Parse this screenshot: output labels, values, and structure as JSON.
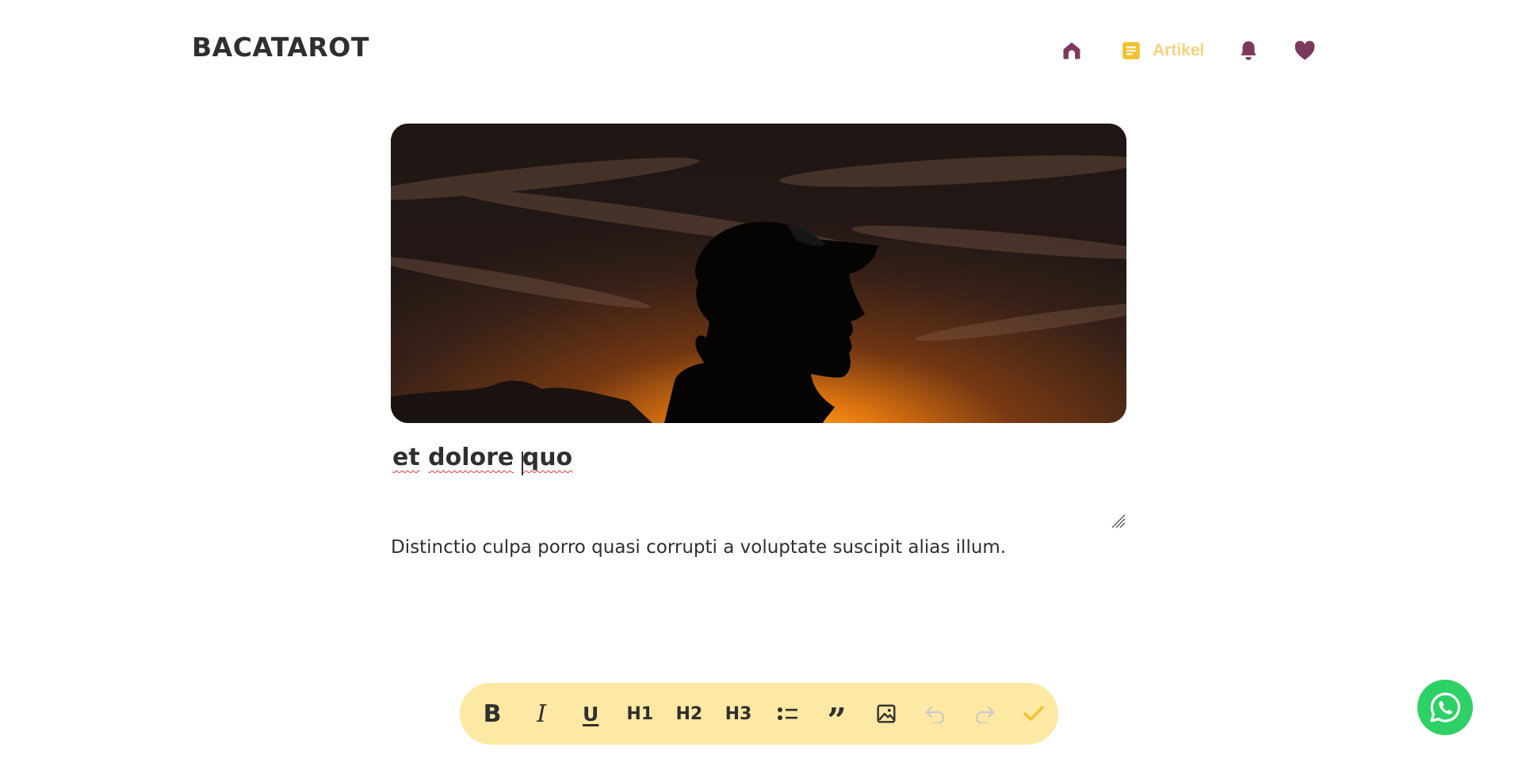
{
  "header": {
    "brand": "BACATAROT",
    "nav": {
      "home_icon": "home-icon",
      "article_icon": "article-icon",
      "article_label": "Artikel",
      "notifications_icon": "bell-icon",
      "favorites_icon": "heart-icon"
    }
  },
  "editor": {
    "cover_image_alt": "silhouette-at-sunset",
    "title": [
      "et",
      "dolore",
      "quo"
    ],
    "body": "Distinctio culpa porro quasi corrupti a voluptate suscipit alias illum."
  },
  "toolbar": {
    "bold": "B",
    "italic": "I",
    "underline": "U",
    "h1": "H1",
    "h2": "H2",
    "h3": "H3",
    "quote": "”",
    "icons": [
      "list-icon",
      "image-icon",
      "undo-icon",
      "redo-icon",
      "check-icon"
    ]
  },
  "colors": {
    "accent_purple": "#7b3a5e",
    "accent_yellow": "#f2c130",
    "article_label": "#f6d27a",
    "toolbar_bg": "#fde9a3",
    "whatsapp_green": "#2ed165",
    "disabled": "#c9c9c9"
  }
}
